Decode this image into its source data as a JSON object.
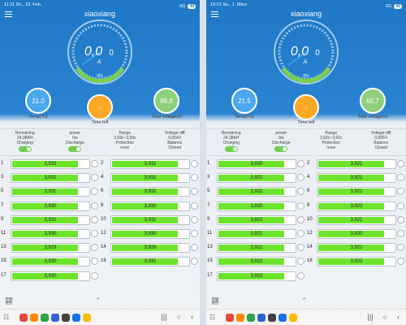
{
  "colors": {
    "header_blue": "#1f78c6",
    "cell_fill": "#6ee42d",
    "temp_circle": "#4aa8ee",
    "time_circle": "#fba925",
    "voltage_circle": "#8fd07d"
  },
  "panels": [
    {
      "status": {
        "time": "11:11",
        "date": "Do., 19. Feb.",
        "signal": "5G",
        "battery": "49"
      },
      "app_title": "xiaoxiang",
      "gauge": {
        "value_main": "0,0",
        "value_decimal": "0",
        "unit": "A",
        "percent_label": "0%"
      },
      "temp": "21.0",
      "temp_label": "Temp(°C)",
      "time_left": "-",
      "time_left_label": "Time left",
      "total_voltage": "66,8",
      "total_voltage_label": "Total voltage(v)",
      "info": {
        "remaining_label": "Remaining",
        "remaining_value": "24,38AH",
        "power_label": "power",
        "power_value": "0w",
        "range_label": "Range",
        "range_value": "3,93v~3,93v",
        "vdiff_label": "Voltage diff",
        "vdiff_value": "0,004V",
        "charging_label": "Charging",
        "discharge_label": "Discharge",
        "protection_label": "Protection",
        "protection_value": "none",
        "balance_label": "Balance",
        "balance_value": "Closed"
      },
      "cells": [
        {
          "n": "1",
          "v": "3,933",
          "fill": 0.84
        },
        {
          "n": "2",
          "v": "3,931",
          "fill": 0.84
        },
        {
          "n": "3",
          "v": "3,931",
          "fill": 0.84
        },
        {
          "n": "4",
          "v": "3,931",
          "fill": 0.84
        },
        {
          "n": "5",
          "v": "3,931",
          "fill": 0.84
        },
        {
          "n": "6",
          "v": "3,932",
          "fill": 0.84
        },
        {
          "n": "7",
          "v": "3,930",
          "fill": 0.84
        },
        {
          "n": "8",
          "v": "3,930",
          "fill": 0.84
        },
        {
          "n": "9",
          "v": "3,931",
          "fill": 0.84
        },
        {
          "n": "10",
          "v": "3,931",
          "fill": 0.84
        },
        {
          "n": "11",
          "v": "3,930",
          "fill": 0.84
        },
        {
          "n": "12",
          "v": "3,930",
          "fill": 0.84
        },
        {
          "n": "13",
          "v": "3,929",
          "fill": 0.84
        },
        {
          "n": "14",
          "v": "3,929",
          "fill": 0.84
        },
        {
          "n": "15",
          "v": "3,930",
          "fill": 0.84
        },
        {
          "n": "16",
          "v": "3,931",
          "fill": 0.84
        },
        {
          "n": "17",
          "v": "3,930",
          "fill": 0.84
        }
      ],
      "bottom_left_icon": "graph-icon",
      "bottom_mid_icon": "double-chevron-up-icon"
    },
    {
      "status": {
        "time": "10:01",
        "date": "So., 1. März",
        "signal": "5G",
        "battery": "45"
      },
      "app_title": "xiaoxiang",
      "gauge": {
        "value_main": "0,0",
        "value_decimal": "0",
        "unit": "A",
        "percent_label": "0%"
      },
      "temp": "21.5",
      "temp_label": "Temp(°C)",
      "time_left": "-",
      "time_left_label": "Time left",
      "total_voltage": "66,7",
      "total_voltage_label": "Total voltage(v)",
      "info": {
        "remaining_label": "Remaining",
        "remaining_value": "24,38AH",
        "power_label": "power",
        "power_value": "0w",
        "range_label": "Range",
        "range_value": "3,92v~3,92v",
        "vdiff_label": "Voltage diff",
        "vdiff_value": "0,005V",
        "charging_label": "Charging",
        "discharge_label": "Discharge",
        "protection_label": "Protection",
        "protection_value": "none",
        "balance_label": "Balance",
        "balance_value": "Closed"
      },
      "cells": [
        {
          "n": "1",
          "v": "3,920",
          "fill": 0.84
        },
        {
          "n": "2",
          "v": "3,921",
          "fill": 0.84
        },
        {
          "n": "3",
          "v": "3,921",
          "fill": 0.84
        },
        {
          "n": "4",
          "v": "3,921",
          "fill": 0.84
        },
        {
          "n": "5",
          "v": "3,921",
          "fill": 0.84
        },
        {
          "n": "6",
          "v": "3,921",
          "fill": 0.84
        },
        {
          "n": "7",
          "v": "3,920",
          "fill": 0.84
        },
        {
          "n": "8",
          "v": "3,922",
          "fill": 0.84
        },
        {
          "n": "9",
          "v": "3,922",
          "fill": 0.84
        },
        {
          "n": "10",
          "v": "3,921",
          "fill": 0.84
        },
        {
          "n": "11",
          "v": "3,921",
          "fill": 0.84
        },
        {
          "n": "12",
          "v": "3,920",
          "fill": 0.84
        },
        {
          "n": "13",
          "v": "3,921",
          "fill": 0.84
        },
        {
          "n": "14",
          "v": "3,921",
          "fill": 0.84
        },
        {
          "n": "15",
          "v": "3,922",
          "fill": 0.84
        },
        {
          "n": "16",
          "v": "3,922",
          "fill": 0.84
        },
        {
          "n": "17",
          "v": "3,922",
          "fill": 0.84
        }
      ],
      "bottom_left_icon": "graph-icon",
      "bottom_mid_icon": "double-chevron-up-icon"
    }
  ],
  "nav": {
    "apps_icon": "apps-grid-icon",
    "back_glyph": "‹",
    "home_glyph": "○",
    "recents_glyph": "|||"
  }
}
